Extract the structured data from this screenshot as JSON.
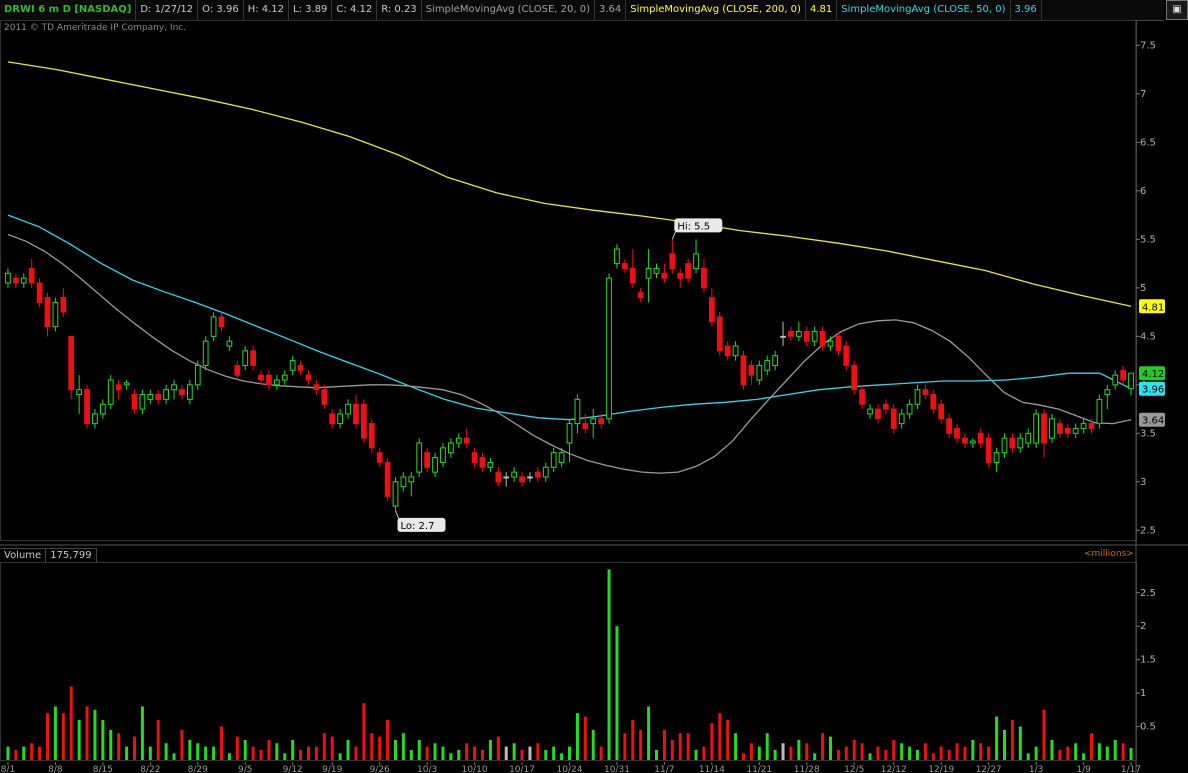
{
  "header": {
    "symbol": "DRWI 6 m D [NASDAQ]",
    "date": "D: 1/27/12",
    "open": "O: 3.96",
    "high": "H: 4.12",
    "low": "L: 3.89",
    "close": "C: 4.12",
    "range": "R: 0.23",
    "sma20_label": "SimpleMovingAvg (CLOSE, 20, 0)",
    "sma20_value": "3.64",
    "sma200_label": "SimpleMovingAvg (CLOSE, 200, 0)",
    "sma200_value": "4.81",
    "sma50_label": "SimpleMovingAvg (CLOSE, 50, 0)",
    "sma50_value": "3.96"
  },
  "copyright": "2011 © TD Ameritrade IP Company, Inc.",
  "volume_panel": {
    "label": "Volume",
    "value": "175,799",
    "units": "<millions>"
  },
  "annotations": {
    "hi": "Hi: 5.5",
    "lo": "Lo: 2.7"
  },
  "colors": {
    "up": "#22dd22",
    "down": "#ee1111",
    "neutral": "#bbbbbb",
    "sma20": "#9a9a9a",
    "sma50": "#33d6e8",
    "sma200": "#e8e830"
  },
  "chart_data": {
    "type": "candlestick",
    "price_axis": {
      "ylim": [
        2.4,
        7.7
      ],
      "ticks": [
        "2.5",
        "3",
        "3.5",
        "4",
        "4.5",
        "5",
        "5.5",
        "6",
        "6.5",
        "7",
        "7.5"
      ]
    },
    "volume_axis": {
      "ylim": [
        0,
        2.9
      ],
      "ticks": [
        "0.5",
        "1",
        "1.5",
        "2",
        "2.5"
      ]
    },
    "last_labels": {
      "close": "4.12",
      "sma50": "3.96",
      "sma200": "4.81",
      "sma20": "3.64"
    },
    "x_labels": [
      "8/1",
      "8/8",
      "8/15",
      "8/22",
      "8/29",
      "9/5",
      "9/12",
      "9/19",
      "9/26",
      "10/3",
      "10/10",
      "10/17",
      "10/24",
      "10/31",
      "11/7",
      "11/14",
      "11/21",
      "11/28",
      "12/5",
      "12/12",
      "12/19",
      "12/27",
      "1/3",
      "1/9",
      "1/17"
    ],
    "candles": [
      [
        5.05,
        5.2,
        5.0,
        5.15
      ],
      [
        5.1,
        5.15,
        5.0,
        5.05
      ],
      [
        5.05,
        5.15,
        5.0,
        5.1
      ],
      [
        5.2,
        5.3,
        5.0,
        5.05
      ],
      [
        5.05,
        5.1,
        4.8,
        4.85
      ],
      [
        4.9,
        4.95,
        4.5,
        4.6
      ],
      [
        4.6,
        4.9,
        4.55,
        4.85
      ],
      [
        4.9,
        5.0,
        4.7,
        4.75
      ],
      [
        4.5,
        4.5,
        3.85,
        3.95
      ],
      [
        3.9,
        4.1,
        3.7,
        3.95
      ],
      [
        3.95,
        4.0,
        3.55,
        3.6
      ],
      [
        3.6,
        3.75,
        3.55,
        3.7
      ],
      [
        3.7,
        3.85,
        3.65,
        3.8
      ],
      [
        3.8,
        4.1,
        3.75,
        4.05
      ],
      [
        4.0,
        4.05,
        3.85,
        3.95
      ],
      [
        4.0,
        4.05,
        3.95,
        4.02
      ],
      [
        3.9,
        3.95,
        3.7,
        3.75
      ],
      [
        3.75,
        3.95,
        3.7,
        3.9
      ],
      [
        3.85,
        3.95,
        3.8,
        3.9
      ],
      [
        3.9,
        3.95,
        3.8,
        3.85
      ],
      [
        3.85,
        4.0,
        3.8,
        3.95
      ],
      [
        3.95,
        4.05,
        3.85,
        4.0
      ],
      [
        3.95,
        4.0,
        3.85,
        3.9
      ],
      [
        3.85,
        4.05,
        3.8,
        4.0
      ],
      [
        4.0,
        4.25,
        3.95,
        4.2
      ],
      [
        4.2,
        4.5,
        4.15,
        4.45
      ],
      [
        4.5,
        4.75,
        4.45,
        4.7
      ],
      [
        4.7,
        4.75,
        4.55,
        4.6
      ],
      [
        4.4,
        4.5,
        4.35,
        4.45
      ],
      [
        4.2,
        4.25,
        4.05,
        4.1
      ],
      [
        4.2,
        4.4,
        4.15,
        4.35
      ],
      [
        4.35,
        4.4,
        4.15,
        4.2
      ],
      [
        4.1,
        4.15,
        4.0,
        4.05
      ],
      [
        4.1,
        4.15,
        3.95,
        4.0
      ],
      [
        4.0,
        4.1,
        3.95,
        4.05
      ],
      [
        4.05,
        4.15,
        4.0,
        4.1
      ],
      [
        4.15,
        4.3,
        4.1,
        4.25
      ],
      [
        4.2,
        4.25,
        4.1,
        4.15
      ],
      [
        4.1,
        4.15,
        4.0,
        4.05
      ],
      [
        4.0,
        4.05,
        3.9,
        3.95
      ],
      [
        3.95,
        4.0,
        3.75,
        3.8
      ],
      [
        3.7,
        3.75,
        3.55,
        3.6
      ],
      [
        3.6,
        3.75,
        3.55,
        3.7
      ],
      [
        3.7,
        3.85,
        3.65,
        3.8
      ],
      [
        3.8,
        3.9,
        3.55,
        3.6
      ],
      [
        3.8,
        3.85,
        3.4,
        3.45
      ],
      [
        3.6,
        3.65,
        3.3,
        3.35
      ],
      [
        3.3,
        3.35,
        3.15,
        3.2
      ],
      [
        3.2,
        3.25,
        2.8,
        2.85
      ],
      [
        2.75,
        3.05,
        2.7,
        3.0
      ],
      [
        2.95,
        3.1,
        2.9,
        3.05
      ],
      [
        3.0,
        3.1,
        2.85,
        3.05
      ],
      [
        3.1,
        3.45,
        3.05,
        3.4
      ],
      [
        3.3,
        3.35,
        3.1,
        3.15
      ],
      [
        3.1,
        3.3,
        3.05,
        3.25
      ],
      [
        3.2,
        3.4,
        3.15,
        3.35
      ],
      [
        3.3,
        3.45,
        3.25,
        3.4
      ],
      [
        3.4,
        3.5,
        3.35,
        3.45
      ],
      [
        3.45,
        3.55,
        3.35,
        3.4
      ],
      [
        3.3,
        3.35,
        3.15,
        3.2
      ],
      [
        3.25,
        3.3,
        3.1,
        3.15
      ],
      [
        3.15,
        3.25,
        3.1,
        3.2
      ],
      [
        3.1,
        3.15,
        2.95,
        3.0
      ],
      [
        3.05,
        3.1,
        2.95,
        3.05
      ],
      [
        3.05,
        3.15,
        3.0,
        3.1
      ],
      [
        3.05,
        3.1,
        2.95,
        3.0
      ],
      [
        3.05,
        3.1,
        3.0,
        3.05
      ],
      [
        3.1,
        3.15,
        3.0,
        3.05
      ],
      [
        3.05,
        3.2,
        3.0,
        3.15
      ],
      [
        3.15,
        3.35,
        3.1,
        3.3
      ],
      [
        3.2,
        3.35,
        3.15,
        3.3
      ],
      [
        3.4,
        3.65,
        3.2,
        3.6
      ],
      [
        3.6,
        3.9,
        3.5,
        3.85
      ],
      [
        3.6,
        3.7,
        3.5,
        3.55
      ],
      [
        3.6,
        3.75,
        3.45,
        3.65
      ],
      [
        3.65,
        3.7,
        3.55,
        3.6
      ],
      [
        3.65,
        5.15,
        3.6,
        5.1
      ],
      [
        5.25,
        5.45,
        5.2,
        5.4
      ],
      [
        5.25,
        5.3,
        5.15,
        5.2
      ],
      [
        5.2,
        5.4,
        5.0,
        5.05
      ],
      [
        4.95,
        5.0,
        4.85,
        4.9
      ],
      [
        5.1,
        5.4,
        4.85,
        5.2
      ],
      [
        5.15,
        5.25,
        5.1,
        5.2
      ],
      [
        5.15,
        5.25,
        5.05,
        5.1
      ],
      [
        5.35,
        5.5,
        5.15,
        5.2
      ],
      [
        5.15,
        5.2,
        5.0,
        5.1
      ],
      [
        5.25,
        5.3,
        5.05,
        5.1
      ],
      [
        5.2,
        5.5,
        5.15,
        5.35
      ],
      [
        5.2,
        5.3,
        4.95,
        5.0
      ],
      [
        4.9,
        5.0,
        4.6,
        4.65
      ],
      [
        4.7,
        4.75,
        4.3,
        4.35
      ],
      [
        4.4,
        4.45,
        4.25,
        4.3
      ],
      [
        4.3,
        4.45,
        4.25,
        4.4
      ],
      [
        4.3,
        4.35,
        3.95,
        4.0
      ],
      [
        4.2,
        4.25,
        4.0,
        4.1
      ],
      [
        4.05,
        4.25,
        4.0,
        4.2
      ],
      [
        4.15,
        4.3,
        4.1,
        4.25
      ],
      [
        4.2,
        4.35,
        4.15,
        4.3
      ],
      [
        4.5,
        4.65,
        4.4,
        4.5
      ],
      [
        4.55,
        4.6,
        4.45,
        4.5
      ],
      [
        4.5,
        4.65,
        4.45,
        4.55
      ],
      [
        4.55,
        4.6,
        4.4,
        4.45
      ],
      [
        4.45,
        4.6,
        4.4,
        4.55
      ],
      [
        4.55,
        4.6,
        4.35,
        4.4
      ],
      [
        4.4,
        4.5,
        4.35,
        4.45
      ],
      [
        4.5,
        4.55,
        4.3,
        4.35
      ],
      [
        4.4,
        4.45,
        4.15,
        4.2
      ],
      [
        4.2,
        4.25,
        3.9,
        3.95
      ],
      [
        3.95,
        4.0,
        3.75,
        3.8
      ],
      [
        3.7,
        3.8,
        3.65,
        3.75
      ],
      [
        3.75,
        3.8,
        3.6,
        3.65
      ],
      [
        3.8,
        3.85,
        3.7,
        3.75
      ],
      [
        3.75,
        3.8,
        3.5,
        3.55
      ],
      [
        3.6,
        3.75,
        3.55,
        3.7
      ],
      [
        3.7,
        3.85,
        3.65,
        3.8
      ],
      [
        3.8,
        4.0,
        3.75,
        3.95
      ],
      [
        3.95,
        4.0,
        3.85,
        3.9
      ],
      [
        3.9,
        3.95,
        3.7,
        3.75
      ],
      [
        3.8,
        3.85,
        3.6,
        3.65
      ],
      [
        3.65,
        3.7,
        3.45,
        3.5
      ],
      [
        3.55,
        3.6,
        3.4,
        3.45
      ],
      [
        3.45,
        3.5,
        3.35,
        3.4
      ],
      [
        3.4,
        3.45,
        3.35,
        3.42
      ],
      [
        3.5,
        3.55,
        3.35,
        3.4
      ],
      [
        3.45,
        3.5,
        3.15,
        3.2
      ],
      [
        3.2,
        3.35,
        3.1,
        3.3
      ],
      [
        3.3,
        3.5,
        3.25,
        3.45
      ],
      [
        3.45,
        3.5,
        3.3,
        3.35
      ],
      [
        3.35,
        3.5,
        3.3,
        3.45
      ],
      [
        3.4,
        3.55,
        3.35,
        3.5
      ],
      [
        3.4,
        3.75,
        3.35,
        3.7
      ],
      [
        3.7,
        3.75,
        3.25,
        3.4
      ],
      [
        3.45,
        3.7,
        3.4,
        3.65
      ],
      [
        3.6,
        3.65,
        3.45,
        3.5
      ],
      [
        3.55,
        3.6,
        3.45,
        3.5
      ],
      [
        3.5,
        3.6,
        3.45,
        3.55
      ],
      [
        3.55,
        3.65,
        3.5,
        3.6
      ],
      [
        3.6,
        3.65,
        3.5,
        3.55
      ],
      [
        3.6,
        3.9,
        3.55,
        3.85
      ],
      [
        3.9,
        4.0,
        3.75,
        3.95
      ],
      [
        4.0,
        4.15,
        3.95,
        4.1
      ],
      [
        4.15,
        4.2,
        4.0,
        4.05
      ],
      [
        3.96,
        4.12,
        3.89,
        4.12
      ]
    ],
    "volume": [
      0.2,
      0.15,
      0.2,
      0.25,
      0.2,
      0.7,
      0.8,
      0.7,
      1.1,
      0.6,
      0.8,
      0.75,
      0.6,
      0.45,
      0.4,
      0.2,
      0.35,
      0.8,
      0.2,
      0.6,
      0.25,
      0.1,
      0.45,
      0.3,
      0.25,
      0.2,
      0.2,
      0.5,
      0.1,
      0.35,
      0.3,
      0.2,
      0.15,
      0.3,
      0.25,
      0.1,
      0.3,
      0.15,
      0.2,
      0.2,
      0.4,
      0.35,
      0.1,
      0.3,
      0.2,
      0.85,
      0.4,
      0.35,
      0.6,
      0.3,
      0.4,
      0.15,
      0.3,
      0.2,
      0.25,
      0.2,
      0.1,
      0.15,
      0.25,
      0.2,
      0.15,
      0.3,
      0.35,
      0.2,
      0.25,
      0.15,
      0.2,
      0.25,
      0.15,
      0.2,
      0.1,
      0.2,
      0.7,
      0.65,
      0.45,
      0.2,
      2.85,
      2.0,
      0.4,
      0.6,
      0.45,
      0.8,
      0.15,
      0.45,
      0.3,
      0.4,
      0.4,
      0.15,
      0.2,
      0.55,
      0.7,
      0.6,
      0.4,
      0.1,
      0.25,
      0.2,
      0.4,
      0.15,
      0.25,
      0.2,
      0.3,
      0.25,
      0.1,
      0.4,
      0.35,
      0.15,
      0.2,
      0.3,
      0.25,
      0.1,
      0.2,
      0.15,
      0.3,
      0.25,
      0.2,
      0.15,
      0.25,
      0.1,
      0.2,
      0.15,
      0.25,
      0.2,
      0.3,
      0.25,
      0.2,
      0.65,
      0.45,
      0.6,
      0.5,
      0.1,
      0.2,
      0.75,
      0.3,
      0.15,
      0.2,
      0.25,
      0.1,
      0.4,
      0.25,
      0.2,
      0.3,
      0.25,
      0.18
    ],
    "sma20": [
      5.55,
      5.48,
      5.38,
      5.25,
      5.1,
      4.94,
      4.78,
      4.63,
      4.49,
      4.36,
      4.25,
      4.16,
      4.09,
      4.04,
      4.01,
      3.99,
      3.98,
      3.97,
      3.98,
      3.99,
      4.0,
      4.0,
      3.99,
      3.97,
      3.95,
      3.9,
      3.82,
      3.72,
      3.6,
      3.48,
      3.38,
      3.29,
      3.22,
      3.17,
      3.13,
      3.1,
      3.09,
      3.1,
      3.16,
      3.26,
      3.42,
      3.64,
      3.85,
      4.05,
      4.25,
      4.42,
      4.55,
      4.63,
      4.66,
      4.67,
      4.64,
      4.56,
      4.45,
      4.29,
      4.1,
      3.92,
      3.82,
      3.79,
      3.75,
      3.68,
      3.61,
      3.6,
      3.64
    ],
    "sma50": [
      5.75,
      5.63,
      5.45,
      5.25,
      5.08,
      4.96,
      4.85,
      4.73,
      4.6,
      4.47,
      4.34,
      4.22,
      4.1,
      3.97,
      3.85,
      3.76,
      3.71,
      3.66,
      3.64,
      3.68,
      3.73,
      3.77,
      3.8,
      3.82,
      3.85,
      3.9,
      3.95,
      3.98,
      4.0,
      4.02,
      4.04,
      4.04,
      4.05,
      4.08,
      4.12,
      4.12,
      3.96
    ],
    "sma200": [
      7.33,
      7.25,
      7.15,
      7.05,
      6.95,
      6.84,
      6.71,
      6.56,
      6.37,
      6.14,
      5.98,
      5.87,
      5.8,
      5.74,
      5.67,
      5.59,
      5.53,
      5.46,
      5.38,
      5.28,
      5.18,
      5.04,
      4.92,
      4.81
    ]
  }
}
